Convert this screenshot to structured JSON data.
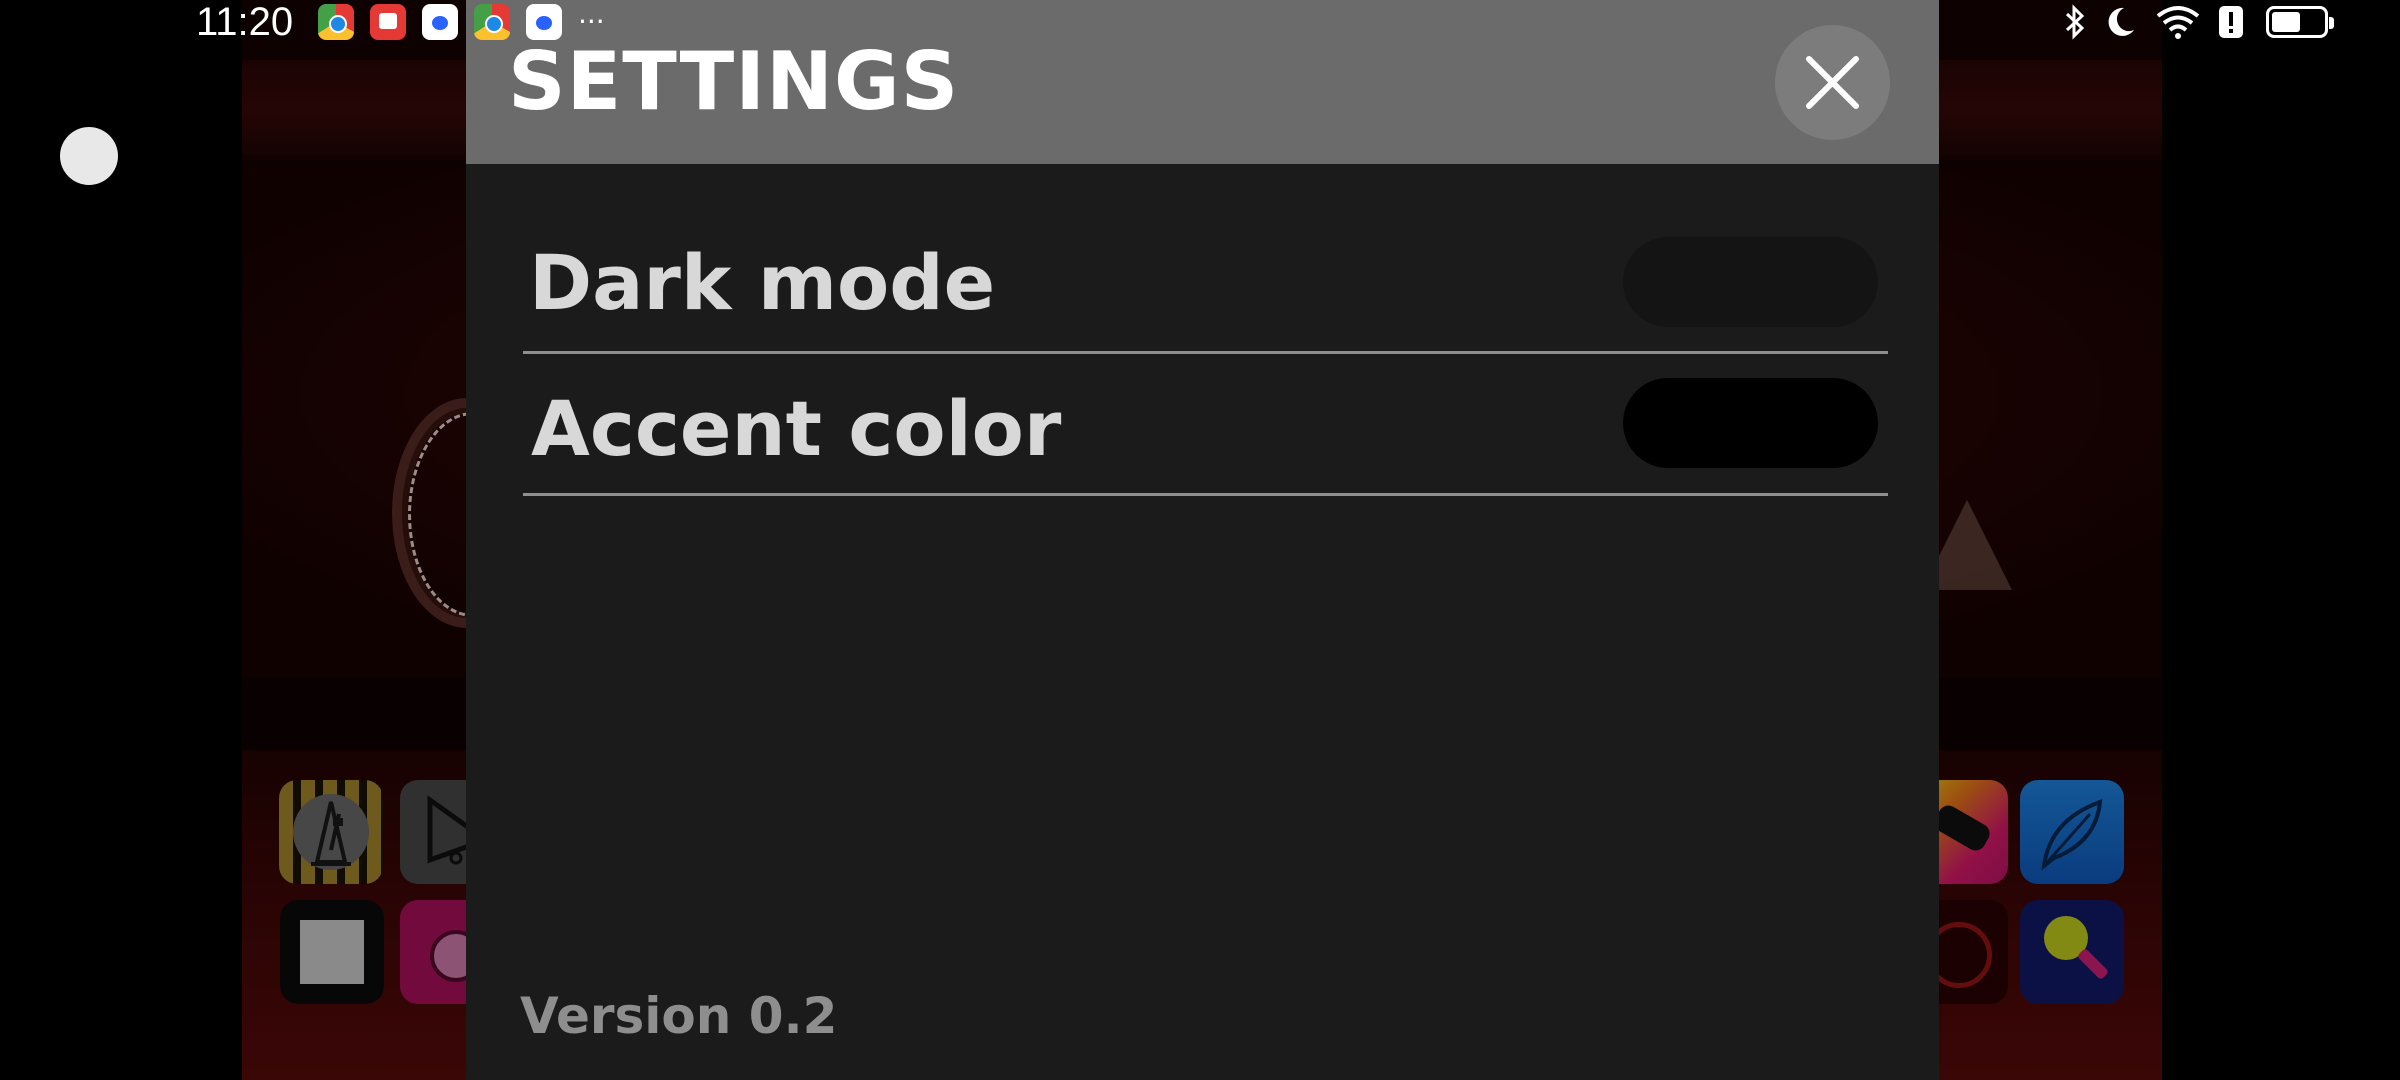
{
  "status_bar": {
    "time": "11:20",
    "notification_icons": [
      "chrome-icon",
      "red-app-icon",
      "baidu-icon",
      "chrome-icon",
      "baidu-icon"
    ],
    "overflow": "···",
    "system_icons": [
      "bluetooth-icon",
      "do-not-disturb-icon",
      "wifi-icon",
      "alert-icon",
      "battery-icon"
    ],
    "battery_level": 0.55
  },
  "settings": {
    "title": "SETTINGS",
    "close_icon": "close-icon",
    "rows": [
      {
        "label": "Dark mode",
        "control_color": "#141414"
      },
      {
        "label": "Accent color",
        "control_color": "#000000"
      }
    ],
    "version": "Version 0.2"
  },
  "colors": {
    "header_bg": "#6b6b6b",
    "panel_bg": "#1b1b1b",
    "label_text": "#d8d8d8",
    "version_text": "#8e8e8e",
    "divider": "#8f8f8f"
  },
  "background_app_icons": [
    "metronome-icon",
    "triangle-icon",
    "square-icon",
    "pink-circle-icon",
    "rainbow-remote-icon",
    "feather-icon",
    "no-sign-icon",
    "search-icon"
  ]
}
